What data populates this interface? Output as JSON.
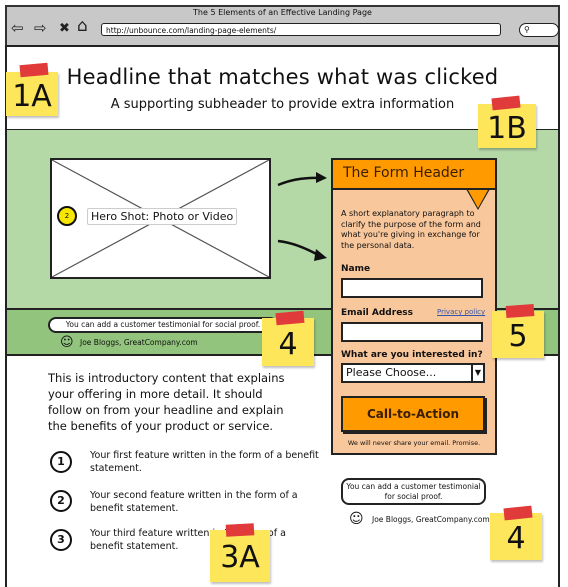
{
  "browser": {
    "window_title": "The 5 Elements of an Effective Landing Page",
    "url": "http://unbounce.com/landing-page-elements/",
    "nav_icons": [
      "back-arrow-icon",
      "forward-arrow-icon",
      "stop-icon",
      "home-icon"
    ],
    "nav_glyphs": [
      "⇦",
      "⇨",
      "✖",
      "⌂"
    ],
    "search_glyph": "⚲"
  },
  "header": {
    "headline": "Headline that matches what was clicked",
    "subheader": "A supporting subheader to provide extra information"
  },
  "hero": {
    "badge_number": "2",
    "label": "Hero Shot: Photo or Video"
  },
  "form": {
    "title": "The Form Header",
    "description": "A short explanatory paragraph to clarify the purpose of the form and what you're giving in exchange for the personal data.",
    "name_label": "Name",
    "name_value": "",
    "email_label": "Email Address",
    "email_value": "",
    "privacy_link": "Privacy policy",
    "interest_label": "What are you interested in?",
    "select_value": "Please Choose...",
    "select_arrow": "▼",
    "cta_label": "Call-to-Action",
    "footer_note": "We will never share your email. Promise."
  },
  "testimonial_top": {
    "quote": "You can add a customer testimonial for social proof.",
    "face_glyph": "☺",
    "author": "Joe Bloggs, GreatCompany.com"
  },
  "intro": {
    "text": "This is introductory content that explains your offering in more detail. It should follow on from your headline and explain the benefits of your product or service."
  },
  "features": [
    {
      "number": "1",
      "text": "Your first feature written in the form of a benefit statement."
    },
    {
      "number": "2",
      "text": "Your second feature written in the form of a benefit statement."
    },
    {
      "number": "3",
      "text": "Your third feature written in the form of a benefit statement."
    }
  ],
  "testimonial_bottom": {
    "quote": "You can add a customer testimonial for social proof.",
    "face_glyph": "☺",
    "author": "Joe Bloggs, GreatCompany.com"
  },
  "sticky_notes": [
    {
      "label": "1A"
    },
    {
      "label": "1B"
    },
    {
      "label": "4"
    },
    {
      "label": "5"
    },
    {
      "label": "4"
    },
    {
      "label": "3A"
    }
  ],
  "colors": {
    "chrome_gray": "#c8c8c8",
    "hero_green": "#b5d8a7",
    "testimonial_green": "#92c47d",
    "form_peach": "#f8c79c",
    "form_orange": "#ff9a00",
    "sticky_yellow": "#fde65a",
    "tape_red": "#e03a3a"
  }
}
